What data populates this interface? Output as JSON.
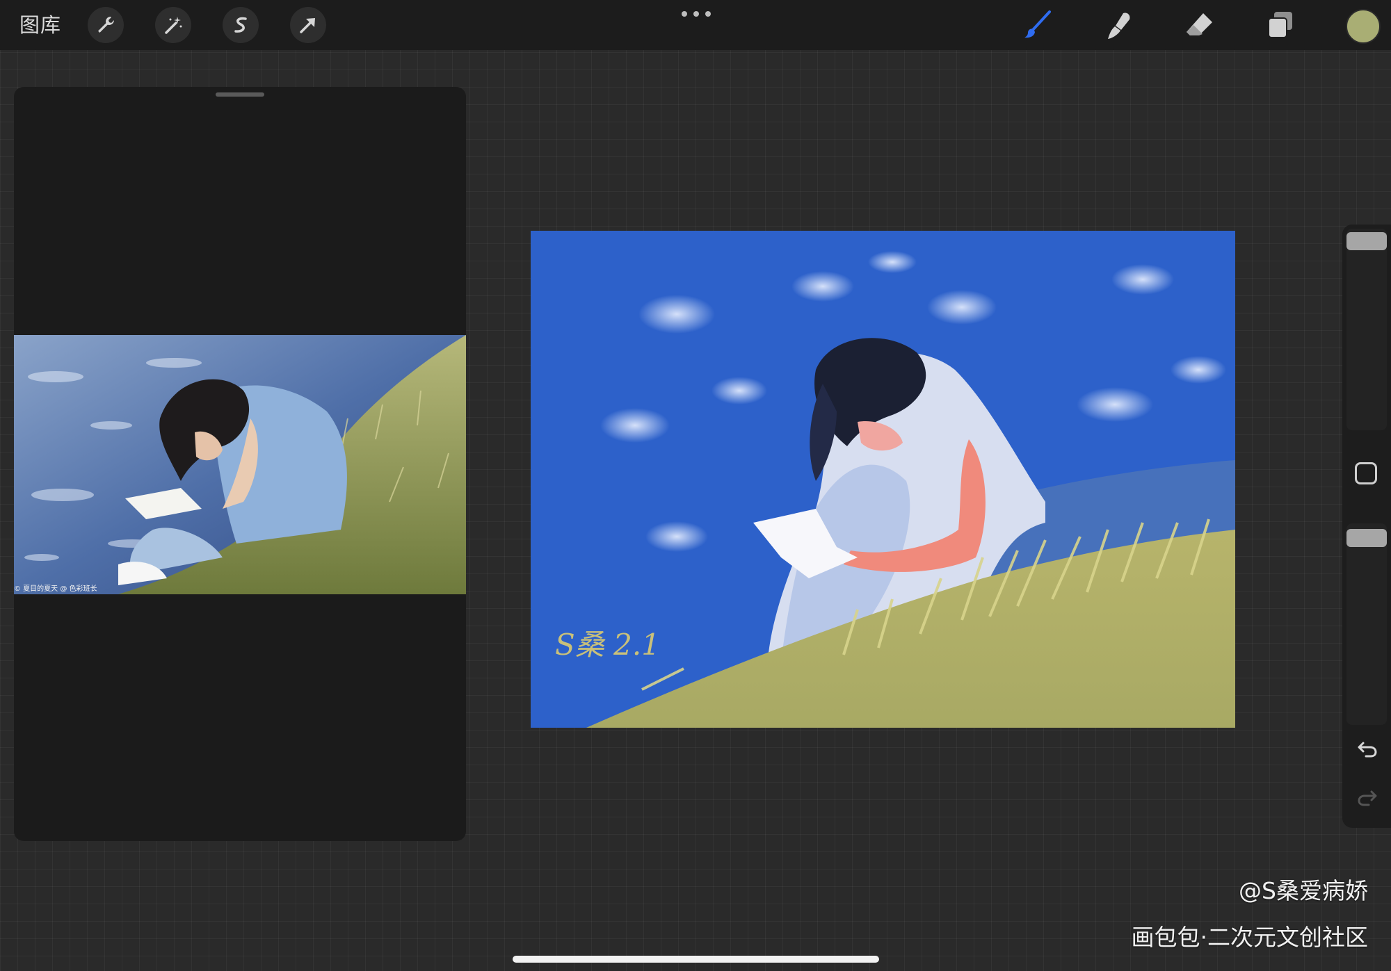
{
  "toolbar": {
    "gallery_label": "图库",
    "left_tools": [
      "wrench-icon",
      "magic-wand-icon",
      "selection-s-icon",
      "transform-arrow-icon"
    ],
    "right_tools": [
      "brush-icon",
      "smudge-icon",
      "eraser-icon",
      "layers-icon"
    ],
    "accent": "#2f6cf0",
    "current_color": "#a9ae74"
  },
  "reference": {
    "photo_caption": "© 夏目的夏天 @ 色彩班长"
  },
  "artwork": {
    "signature": "S桑 2.1"
  },
  "sidebar": {
    "brush_size_level": 0.98,
    "opacity_level": 0.97
  },
  "watermark": {
    "author": "@S桑爱病娇",
    "site": "画包包·二次元文创社区"
  }
}
